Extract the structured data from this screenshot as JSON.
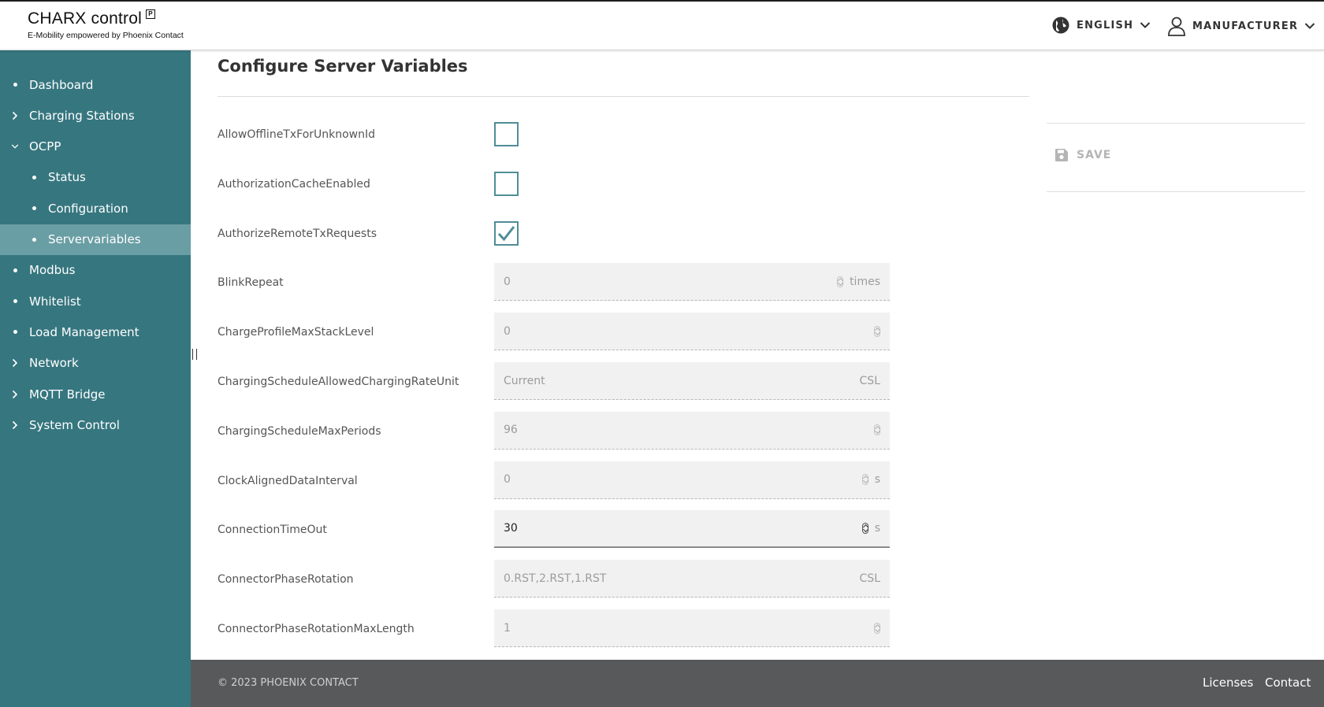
{
  "header": {
    "logo_title": "CHARX control",
    "logo_subtitle": "E-Mobility empowered by Phoenix Contact",
    "language_label": "ENGLISH",
    "user_label": "MANUFACTURER",
    "icons": {
      "language": "globe-icon",
      "user": "user-icon",
      "dropdown": "chevron-down-icon"
    }
  },
  "sidebar": {
    "items": [
      {
        "label": "Dashboard",
        "marker": "bullet"
      },
      {
        "label": "Charging Stations",
        "marker": "chevron-right"
      },
      {
        "label": "OCPP",
        "marker": "chevron-down"
      },
      {
        "label": "Status",
        "marker": "bullet"
      },
      {
        "label": "Configuration",
        "marker": "bullet"
      },
      {
        "label": "Servervariables",
        "marker": "bullet",
        "active": true
      },
      {
        "label": "Modbus",
        "marker": "bullet"
      },
      {
        "label": "Whitelist",
        "marker": "bullet"
      },
      {
        "label": "Load Management",
        "marker": "bullet"
      },
      {
        "label": "Network",
        "marker": "chevron-right"
      },
      {
        "label": "MQTT Bridge",
        "marker": "chevron-right"
      },
      {
        "label": "System Control",
        "marker": "chevron-right"
      }
    ]
  },
  "main": {
    "title": "Configure Server Variables",
    "rows": [
      {
        "label": "AllowOfflineTxForUnknownId",
        "type": "checkbox",
        "checked": false
      },
      {
        "label": "AuthorizationCacheEnabled",
        "type": "checkbox",
        "checked": false
      },
      {
        "label": "AuthorizeRemoteTxRequests",
        "type": "checkbox",
        "checked": true
      },
      {
        "label": "BlinkRepeat",
        "type": "number",
        "value": "0",
        "unit": "times"
      },
      {
        "label": "ChargeProfileMaxStackLevel",
        "type": "number",
        "value": "0",
        "unit": ""
      },
      {
        "label": "ChargingScheduleAllowedChargingRateUnit",
        "type": "text",
        "value": "Current",
        "unit": "CSL"
      },
      {
        "label": "ChargingScheduleMaxPeriods",
        "type": "number",
        "value": "96",
        "unit": ""
      },
      {
        "label": "ClockAlignedDataInterval",
        "type": "number",
        "value": "0",
        "unit": "s"
      },
      {
        "label": "ConnectionTimeOut",
        "type": "number",
        "value": "30",
        "unit": "s",
        "editable": true
      },
      {
        "label": "ConnectorPhaseRotation",
        "type": "text",
        "value": "0.RST,2.RST,1.RST",
        "unit": "CSL"
      },
      {
        "label": "ConnectorPhaseRotationMaxLength",
        "type": "number",
        "value": "1",
        "unit": ""
      }
    ]
  },
  "save": {
    "label": "SAVE",
    "icon": "floppy-disk-icon"
  },
  "footer": {
    "copyright": "© 2023 PHOENIX CONTACT",
    "links": [
      "Licenses",
      "Contact"
    ]
  },
  "colors": {
    "sidebar": "#36767f",
    "sidebar_active": "#6a9ea5",
    "checkbox_border": "#4f8d96",
    "footer": "#58595b"
  }
}
